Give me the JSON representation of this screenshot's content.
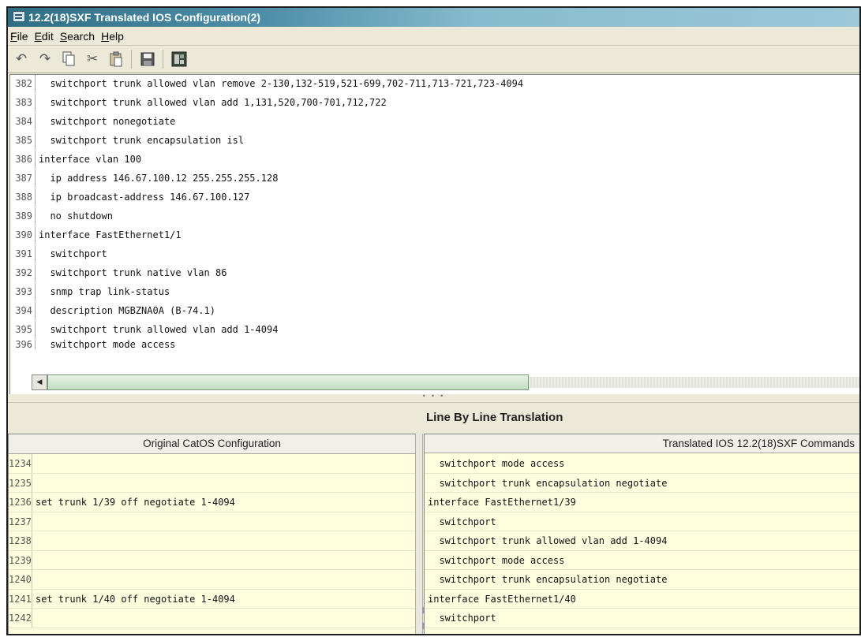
{
  "window": {
    "title": "12.2(18)SXF Translated IOS Configuration(2)"
  },
  "menubar": {
    "items": [
      "File",
      "Edit",
      "Search",
      "Help"
    ]
  },
  "toolbar": {
    "icons": [
      "undo-icon",
      "redo-icon",
      "copy-icon",
      "cut-icon",
      "paste-icon",
      "save-icon",
      "export-icon"
    ]
  },
  "editor": {
    "lines": [
      {
        "num": "382",
        "text": "  switchport trunk allowed vlan remove 2-130,132-519,521-699,702-711,713-721,723-4094"
      },
      {
        "num": "383",
        "text": "  switchport trunk allowed vlan add 1,131,520,700-701,712,722"
      },
      {
        "num": "384",
        "text": "  switchport nonegotiate"
      },
      {
        "num": "385",
        "text": "  switchport trunk encapsulation isl"
      },
      {
        "num": "386",
        "text": "interface vlan 100"
      },
      {
        "num": "387",
        "text": "  ip address 146.67.100.12 255.255.255.128"
      },
      {
        "num": "388",
        "text": "  ip broadcast-address 146.67.100.127"
      },
      {
        "num": "389",
        "text": "  no shutdown"
      },
      {
        "num": "390",
        "text": "interface FastEthernet1/1"
      },
      {
        "num": "391",
        "text": "  switchport"
      },
      {
        "num": "392",
        "text": "  switchport trunk native vlan 86"
      },
      {
        "num": "393",
        "text": "  snmp trap link-status"
      },
      {
        "num": "394",
        "text": "  description MGBZNA0A (B-74.1)"
      },
      {
        "num": "395",
        "text": "  switchport trunk allowed vlan add 1-4094"
      },
      {
        "num": "396",
        "text": "  switchport mode access"
      }
    ]
  },
  "translation": {
    "title": "Line By Line Translation",
    "left_header": "Original CatOS Configuration",
    "right_header": "Translated IOS 12.2(18)SXF Commands",
    "left_rows": [
      {
        "num": "1234",
        "text": ""
      },
      {
        "num": "1235",
        "text": ""
      },
      {
        "num": "1236",
        "text": "set trunk 1/39 off negotiate 1-4094"
      },
      {
        "num": "1237",
        "text": ""
      },
      {
        "num": "1238",
        "text": ""
      },
      {
        "num": "1239",
        "text": ""
      },
      {
        "num": "1240",
        "text": ""
      },
      {
        "num": "1241",
        "text": "set trunk 1/40 off negotiate 1-4094"
      },
      {
        "num": "1242",
        "text": ""
      }
    ],
    "right_rows": [
      "  switchport mode access",
      "  switchport trunk encapsulation negotiate",
      "interface FastEthernet1/39",
      "  switchport",
      "  switchport trunk allowed vlan add 1-4094",
      "  switchport mode access",
      "  switchport trunk encapsulation negotiate",
      "interface FastEthernet1/40",
      "  switchport"
    ]
  }
}
